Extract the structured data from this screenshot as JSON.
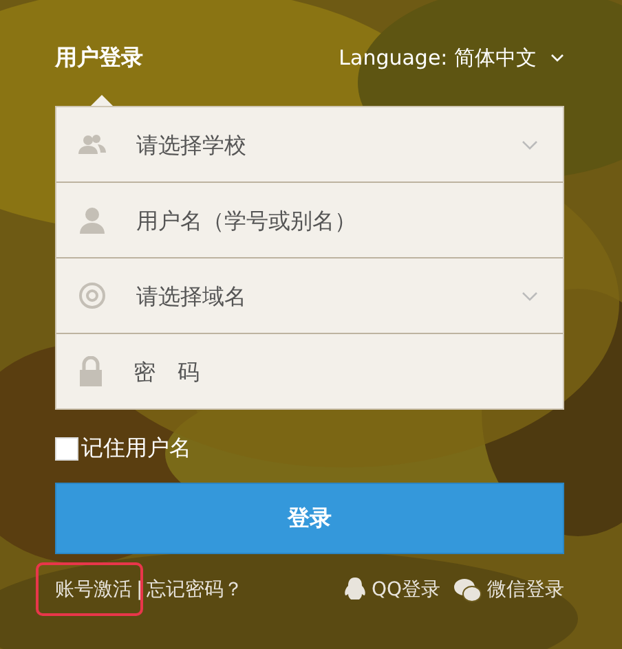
{
  "header": {
    "title": "用户登录",
    "language": {
      "label": "Language: 简体中文"
    }
  },
  "fields": [
    {
      "kind": "select",
      "placeholder": "请选择学校"
    },
    {
      "kind": "input",
      "placeholder": "用户名（学号或别名）"
    },
    {
      "kind": "select",
      "placeholder": "请选择域名"
    },
    {
      "kind": "password",
      "placeholder": "密　码"
    }
  ],
  "remember": {
    "label": "记住用户名",
    "checked": false
  },
  "submit": "登录",
  "links": {
    "activate": {
      "label": "账号激活",
      "highlighted": true
    },
    "separator": "|",
    "forgot": {
      "label": "忘记密码？"
    }
  },
  "social": [
    {
      "label": "QQ登录"
    },
    {
      "label": "微信登录"
    }
  ]
}
